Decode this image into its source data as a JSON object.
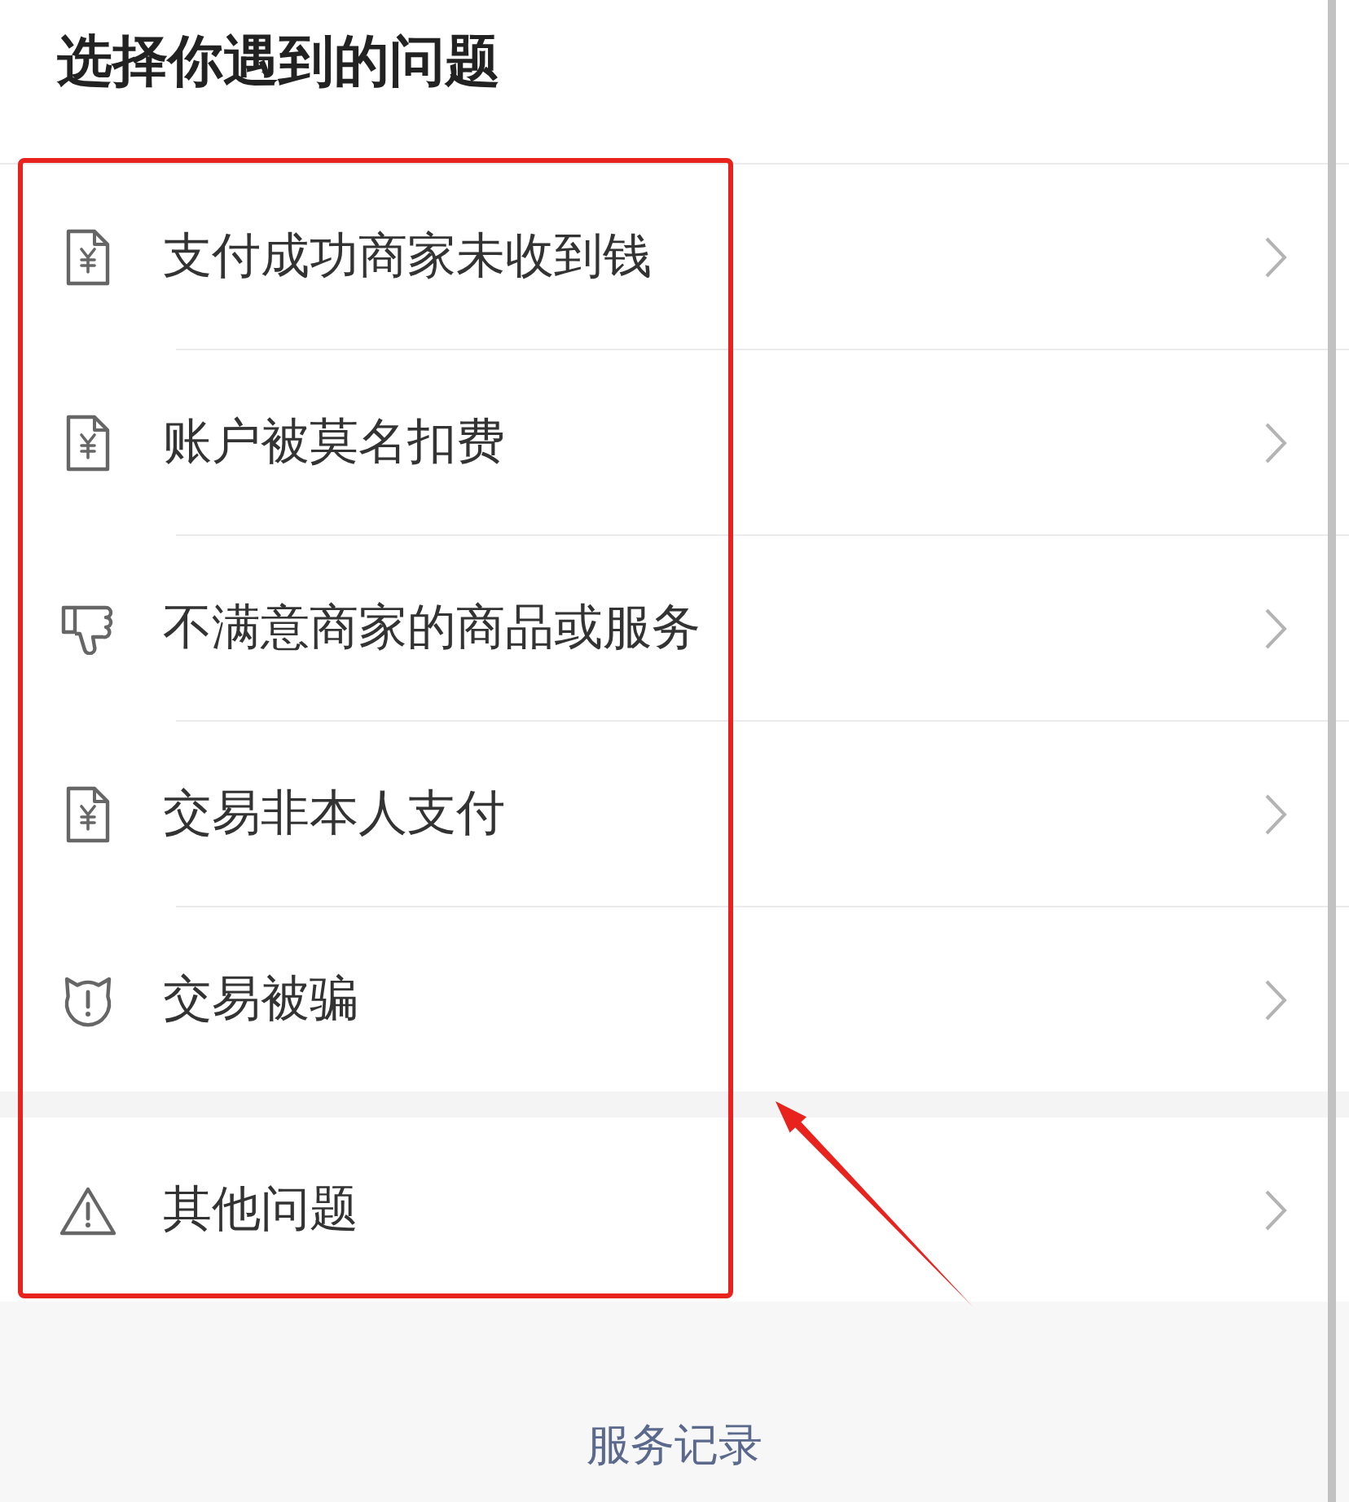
{
  "title": "选择你遇到的问题",
  "groups": [
    {
      "items": [
        {
          "kind": "bill",
          "label": "支付成功商家未收到钱"
        },
        {
          "kind": "bill",
          "label": "账户被莫名扣费"
        },
        {
          "kind": "dislike",
          "label": "不满意商家的商品或服务"
        },
        {
          "kind": "bill",
          "label": "交易非本人支付"
        },
        {
          "kind": "fraud",
          "label": "交易被骗"
        }
      ]
    },
    {
      "items": [
        {
          "kind": "other",
          "label": "其他问题"
        }
      ]
    }
  ],
  "footer_link": "服务记录"
}
